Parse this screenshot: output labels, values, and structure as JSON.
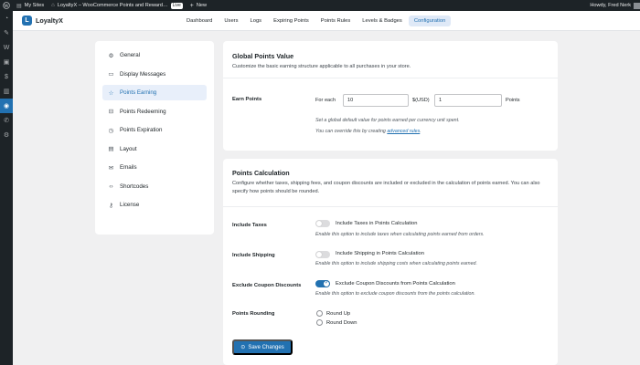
{
  "adminbar": {
    "my_sites": "My Sites",
    "site_name": "LoyaltyX – WooCommerce Points and Reward…",
    "live_badge": "Live",
    "new_label": "New",
    "howdy": "Howdy, Fred Nerk"
  },
  "plugin": {
    "name": "LoyaltyX",
    "tabs": [
      {
        "label": "Dashboard"
      },
      {
        "label": "Users"
      },
      {
        "label": "Logs"
      },
      {
        "label": "Expiring Points"
      },
      {
        "label": "Points Rules"
      },
      {
        "label": "Levels & Badges"
      },
      {
        "label": "Configuration"
      }
    ]
  },
  "settings_nav": {
    "items": [
      {
        "label": "General",
        "icon": "gear-icon"
      },
      {
        "label": "Display Messages",
        "icon": "message-icon"
      },
      {
        "label": "Points Earning",
        "icon": "star-icon"
      },
      {
        "label": "Points Redeeming",
        "icon": "gift-icon"
      },
      {
        "label": "Points Expiration",
        "icon": "clock-icon"
      },
      {
        "label": "Layout",
        "icon": "layout-icon"
      },
      {
        "label": "Emails",
        "icon": "email-icon"
      },
      {
        "label": "Shortcodes",
        "icon": "code-icon"
      },
      {
        "label": "License",
        "icon": "key-icon"
      }
    ],
    "active": "Points Earning"
  },
  "global_points": {
    "title": "Global Points Value",
    "description": "Customize the basic earning structure applicable to all purchases in your store.",
    "earn_label": "Earn Points",
    "for_each": "For each",
    "amount_value": "10",
    "currency_label": "$(USD)",
    "points_value": "1",
    "points_label": "Points",
    "help1": "Set a global default value for points earned per currency unit spent.",
    "help2_prefix": "You can override this by creating",
    "help2_link": "advanced rules",
    "help2_suffix": "."
  },
  "points_calc": {
    "title": "Points Calculation",
    "description": "Configure whether taxes, shipping fees, and coupon discounts are included or excluded in the calculation of points earned. You can also specify how points should be rounded.",
    "taxes": {
      "label": "Include Taxes",
      "toggle_label": "Include Taxes in Points Calculation",
      "help": "Enable this option to include taxes when calculating points earned from orders.",
      "enabled": false
    },
    "shipping": {
      "label": "Include Shipping",
      "toggle_label": "Include Shipping in Points Calculation",
      "help": "Enable this option to include shipping costs when calculating points earned.",
      "enabled": false
    },
    "coupon": {
      "label": "Exclude Coupon Discounts",
      "toggle_label": "Exclude Coupon Discounts from Points Calculation",
      "help": "Enable this option to exclude coupon discounts from the points calculation.",
      "enabled": true
    },
    "rounding": {
      "label": "Points Rounding",
      "options": [
        "Round Up",
        "Round Down"
      ]
    }
  },
  "save_button": "Save Changes",
  "colors": {
    "accent": "#2271b1",
    "admin_bar": "#1d2327",
    "background": "#f0f0f1"
  }
}
